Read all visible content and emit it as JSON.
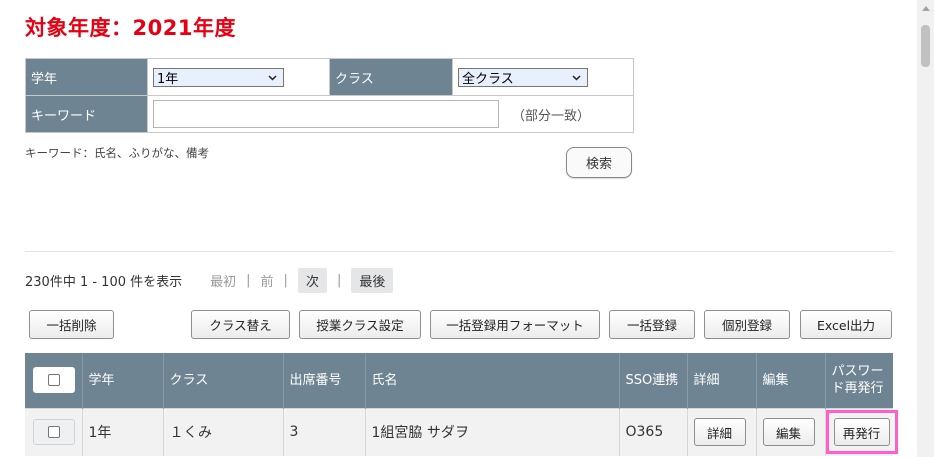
{
  "page": {
    "title": "対象年度：2021年度"
  },
  "filter": {
    "grade_label": "学年",
    "grade_value": "1年",
    "class_label": "クラス",
    "class_value": "全クラス",
    "keyword_label": "キーワード",
    "keyword_value": "",
    "keyword_note": "（部分一致）",
    "keyword_hint": "キーワード：氏名、ふりがな、備考",
    "search_label": "検索"
  },
  "pager": {
    "count_text": "230件中 1 - 100 件を表示",
    "first": "最初",
    "prev": "前",
    "next": "次",
    "last": "最後",
    "sep": "|"
  },
  "actions": {
    "bulk_delete": "一括削除",
    "class_change": "クラス替え",
    "lesson_class_setting": "授業クラス設定",
    "bulk_format": "一括登録用フォーマット",
    "bulk_register": "一括登録",
    "individual_register": "個別登録",
    "excel_export": "Excel出力"
  },
  "table": {
    "headers": {
      "grade": "学年",
      "class": "クラス",
      "attendance_no": "出席番号",
      "name": "氏名",
      "sso": "SSO連携",
      "detail": "詳細",
      "edit": "編集",
      "password_reissue_1": "パスワー",
      "password_reissue_2": "ド再発行"
    },
    "rows": [
      {
        "grade": "1年",
        "class": "１くみ",
        "attendance_no": "3",
        "name": "1組宮脇 サダヲ",
        "sso": "O365",
        "detail_btn": "詳細",
        "edit_btn": "編集",
        "reissue_btn": "再発行"
      }
    ]
  },
  "colors": {
    "title_red": "#e60012",
    "header_bg": "#6f8492",
    "highlight": "#ff5ecb"
  },
  "icons": {
    "select_caret": "chevron-down-icon",
    "scroll_up": "scroll-up-arrow-icon"
  }
}
